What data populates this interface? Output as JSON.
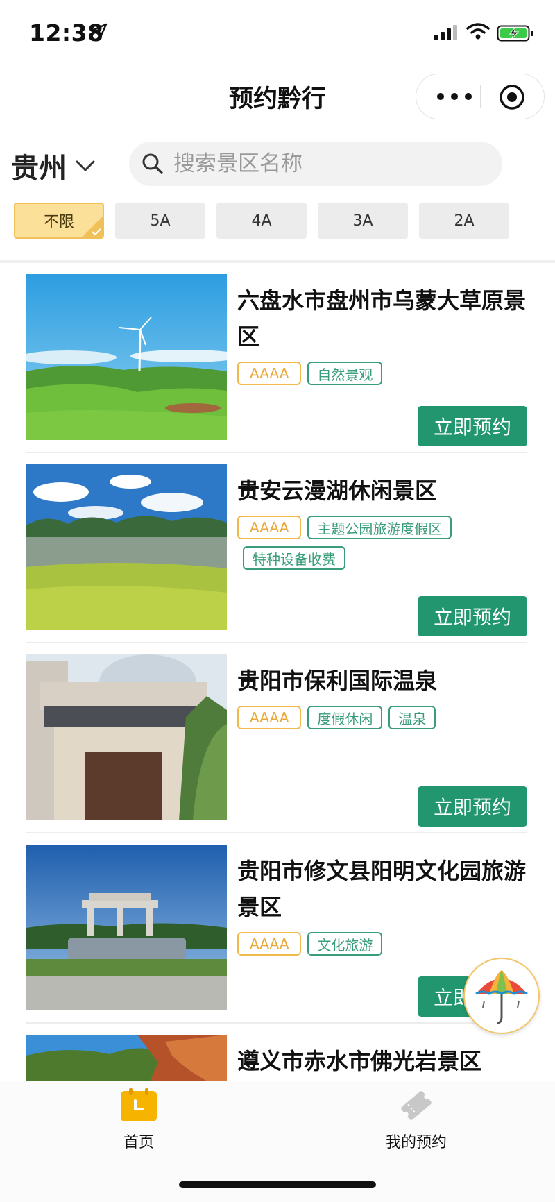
{
  "status_bar": {
    "time": "12:38"
  },
  "navbar": {
    "title": "预约黔行"
  },
  "search": {
    "city": "贵州",
    "placeholder": "搜索景区名称"
  },
  "filters": [
    {
      "label": "不限",
      "active": true
    },
    {
      "label": "5A",
      "active": false
    },
    {
      "label": "4A",
      "active": false
    },
    {
      "label": "3A",
      "active": false
    },
    {
      "label": "2A",
      "active": false
    }
  ],
  "scenic_list": [
    {
      "name": "六盘水市盘州市乌蒙大草原景区",
      "level": "AAAA",
      "tags": [
        "自然景观"
      ],
      "button": "立即预约"
    },
    {
      "name": "贵安云漫湖休闲景区",
      "level": "AAAA",
      "tags": [
        "主题公园旅游度假区",
        "特种设备收费"
      ],
      "button": "立即预约"
    },
    {
      "name": "贵阳市保利国际温泉",
      "level": "AAAA",
      "tags": [
        "度假休闲",
        "温泉"
      ],
      "button": "立即预约"
    },
    {
      "name": "贵阳市修文县阳明文化园旅游景区",
      "level": "AAAA",
      "tags": [
        "文化旅游"
      ],
      "button": "立即预约"
    },
    {
      "name": "遵义市赤水市佛光岩景区",
      "level": "",
      "tags": [],
      "button": ""
    }
  ],
  "tabbar": [
    {
      "label": "首页",
      "icon": "calendar-icon",
      "active": true
    },
    {
      "label": "我的预约",
      "icon": "ticket-icon",
      "active": false
    }
  ],
  "colors": {
    "accent_green": "#21966f",
    "tag_green": "#3a9d79",
    "level_orange": "#f0b94c",
    "chip_active": "#fbe09a"
  }
}
